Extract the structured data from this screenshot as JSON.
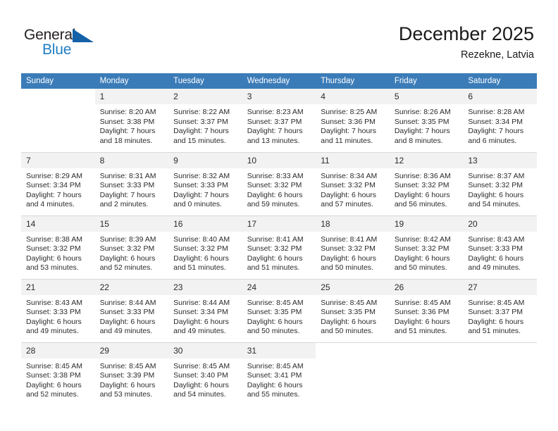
{
  "brand": {
    "name_part1": "General",
    "name_part2": "Blue",
    "triangle_icon": "triangle-logo-icon",
    "color_dark": "#231f20",
    "color_blue": "#1f7dc4",
    "triangle_color": "#1461a8"
  },
  "header": {
    "title": "December 2025",
    "subtitle": "Rezekne, Latvia",
    "header_bg": "#3b7cb8",
    "header_text_color": "#ffffff",
    "daynum_bg": "#f2f2f2"
  },
  "weekdays": [
    "Sunday",
    "Monday",
    "Tuesday",
    "Wednesday",
    "Thursday",
    "Friday",
    "Saturday"
  ],
  "weeks": [
    [
      {
        "day": "",
        "blank": true,
        "lines": []
      },
      {
        "day": "1",
        "lines": [
          "Sunrise: 8:20 AM",
          "Sunset: 3:38 PM",
          "Daylight: 7 hours",
          "and 18 minutes."
        ]
      },
      {
        "day": "2",
        "lines": [
          "Sunrise: 8:22 AM",
          "Sunset: 3:37 PM",
          "Daylight: 7 hours",
          "and 15 minutes."
        ]
      },
      {
        "day": "3",
        "lines": [
          "Sunrise: 8:23 AM",
          "Sunset: 3:37 PM",
          "Daylight: 7 hours",
          "and 13 minutes."
        ]
      },
      {
        "day": "4",
        "lines": [
          "Sunrise: 8:25 AM",
          "Sunset: 3:36 PM",
          "Daylight: 7 hours",
          "and 11 minutes."
        ]
      },
      {
        "day": "5",
        "lines": [
          "Sunrise: 8:26 AM",
          "Sunset: 3:35 PM",
          "Daylight: 7 hours",
          "and 8 minutes."
        ]
      },
      {
        "day": "6",
        "lines": [
          "Sunrise: 8:28 AM",
          "Sunset: 3:34 PM",
          "Daylight: 7 hours",
          "and 6 minutes."
        ]
      }
    ],
    [
      {
        "day": "7",
        "lines": [
          "Sunrise: 8:29 AM",
          "Sunset: 3:34 PM",
          "Daylight: 7 hours",
          "and 4 minutes."
        ]
      },
      {
        "day": "8",
        "lines": [
          "Sunrise: 8:31 AM",
          "Sunset: 3:33 PM",
          "Daylight: 7 hours",
          "and 2 minutes."
        ]
      },
      {
        "day": "9",
        "lines": [
          "Sunrise: 8:32 AM",
          "Sunset: 3:33 PM",
          "Daylight: 7 hours",
          "and 0 minutes."
        ]
      },
      {
        "day": "10",
        "lines": [
          "Sunrise: 8:33 AM",
          "Sunset: 3:32 PM",
          "Daylight: 6 hours",
          "and 59 minutes."
        ]
      },
      {
        "day": "11",
        "lines": [
          "Sunrise: 8:34 AM",
          "Sunset: 3:32 PM",
          "Daylight: 6 hours",
          "and 57 minutes."
        ]
      },
      {
        "day": "12",
        "lines": [
          "Sunrise: 8:36 AM",
          "Sunset: 3:32 PM",
          "Daylight: 6 hours",
          "and 56 minutes."
        ]
      },
      {
        "day": "13",
        "lines": [
          "Sunrise: 8:37 AM",
          "Sunset: 3:32 PM",
          "Daylight: 6 hours",
          "and 54 minutes."
        ]
      }
    ],
    [
      {
        "day": "14",
        "lines": [
          "Sunrise: 8:38 AM",
          "Sunset: 3:32 PM",
          "Daylight: 6 hours",
          "and 53 minutes."
        ]
      },
      {
        "day": "15",
        "lines": [
          "Sunrise: 8:39 AM",
          "Sunset: 3:32 PM",
          "Daylight: 6 hours",
          "and 52 minutes."
        ]
      },
      {
        "day": "16",
        "lines": [
          "Sunrise: 8:40 AM",
          "Sunset: 3:32 PM",
          "Daylight: 6 hours",
          "and 51 minutes."
        ]
      },
      {
        "day": "17",
        "lines": [
          "Sunrise: 8:41 AM",
          "Sunset: 3:32 PM",
          "Daylight: 6 hours",
          "and 51 minutes."
        ]
      },
      {
        "day": "18",
        "lines": [
          "Sunrise: 8:41 AM",
          "Sunset: 3:32 PM",
          "Daylight: 6 hours",
          "and 50 minutes."
        ]
      },
      {
        "day": "19",
        "lines": [
          "Sunrise: 8:42 AM",
          "Sunset: 3:32 PM",
          "Daylight: 6 hours",
          "and 50 minutes."
        ]
      },
      {
        "day": "20",
        "lines": [
          "Sunrise: 8:43 AM",
          "Sunset: 3:33 PM",
          "Daylight: 6 hours",
          "and 49 minutes."
        ]
      }
    ],
    [
      {
        "day": "21",
        "lines": [
          "Sunrise: 8:43 AM",
          "Sunset: 3:33 PM",
          "Daylight: 6 hours",
          "and 49 minutes."
        ]
      },
      {
        "day": "22",
        "lines": [
          "Sunrise: 8:44 AM",
          "Sunset: 3:33 PM",
          "Daylight: 6 hours",
          "and 49 minutes."
        ]
      },
      {
        "day": "23",
        "lines": [
          "Sunrise: 8:44 AM",
          "Sunset: 3:34 PM",
          "Daylight: 6 hours",
          "and 49 minutes."
        ]
      },
      {
        "day": "24",
        "lines": [
          "Sunrise: 8:45 AM",
          "Sunset: 3:35 PM",
          "Daylight: 6 hours",
          "and 50 minutes."
        ]
      },
      {
        "day": "25",
        "lines": [
          "Sunrise: 8:45 AM",
          "Sunset: 3:35 PM",
          "Daylight: 6 hours",
          "and 50 minutes."
        ]
      },
      {
        "day": "26",
        "lines": [
          "Sunrise: 8:45 AM",
          "Sunset: 3:36 PM",
          "Daylight: 6 hours",
          "and 51 minutes."
        ]
      },
      {
        "day": "27",
        "lines": [
          "Sunrise: 8:45 AM",
          "Sunset: 3:37 PM",
          "Daylight: 6 hours",
          "and 51 minutes."
        ]
      }
    ],
    [
      {
        "day": "28",
        "lines": [
          "Sunrise: 8:45 AM",
          "Sunset: 3:38 PM",
          "Daylight: 6 hours",
          "and 52 minutes."
        ]
      },
      {
        "day": "29",
        "lines": [
          "Sunrise: 8:45 AM",
          "Sunset: 3:39 PM",
          "Daylight: 6 hours",
          "and 53 minutes."
        ]
      },
      {
        "day": "30",
        "lines": [
          "Sunrise: 8:45 AM",
          "Sunset: 3:40 PM",
          "Daylight: 6 hours",
          "and 54 minutes."
        ]
      },
      {
        "day": "31",
        "lines": [
          "Sunrise: 8:45 AM",
          "Sunset: 3:41 PM",
          "Daylight: 6 hours",
          "and 55 minutes."
        ]
      },
      {
        "day": "",
        "blank": true,
        "lines": []
      },
      {
        "day": "",
        "blank": true,
        "lines": []
      },
      {
        "day": "",
        "blank": true,
        "lines": []
      }
    ]
  ]
}
